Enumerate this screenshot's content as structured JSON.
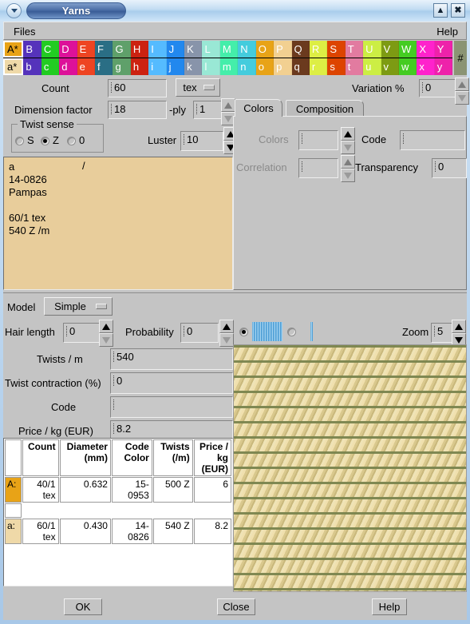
{
  "window": {
    "title": "Yarns",
    "menu_icon": "chevron-down-icon",
    "shade_icon": "shade-icon",
    "close_icon": "close-icon"
  },
  "menubar": {
    "files": "Files",
    "help": "Help"
  },
  "palette": {
    "hash": "#",
    "upper": [
      {
        "label": "A*",
        "color": "#E8A317",
        "selected": true
      },
      {
        "label": "B",
        "color": "#5533BB"
      },
      {
        "label": "C",
        "color": "#22CC22"
      },
      {
        "label": "D",
        "color": "#DD1199"
      },
      {
        "label": "E",
        "color": "#EE4422"
      },
      {
        "label": "F",
        "color": "#2A6E85"
      },
      {
        "label": "G",
        "color": "#5FA06A"
      },
      {
        "label": "H",
        "color": "#CC2211"
      },
      {
        "label": "I",
        "color": "#55BBFF"
      },
      {
        "label": "J",
        "color": "#2288EE"
      },
      {
        "label": "K",
        "color": "#8894AA"
      },
      {
        "label": "L",
        "color": "#99E8D5"
      },
      {
        "label": "M",
        "color": "#44EEAA"
      },
      {
        "label": "N",
        "color": "#44CCDD"
      },
      {
        "label": "O",
        "color": "#E8A317"
      },
      {
        "label": "P",
        "color": "#F2D091"
      },
      {
        "label": "Q",
        "color": "#6B3A1E"
      },
      {
        "label": "R",
        "color": "#DDEE44"
      },
      {
        "label": "S",
        "color": "#DD4400"
      },
      {
        "label": "T",
        "color": "#E27BA0"
      },
      {
        "label": "U",
        "color": "#CCEE44"
      },
      {
        "label": "V",
        "color": "#7D9B13"
      },
      {
        "label": "W",
        "color": "#44CC22"
      },
      {
        "label": "X",
        "color": "#FF22CC"
      },
      {
        "label": "Y",
        "color": "#EE22AA"
      }
    ],
    "lower": [
      {
        "label": "a*",
        "color": "#EFD9A8",
        "selected": true
      },
      {
        "label": "b",
        "color": "#5533BB"
      },
      {
        "label": "c",
        "color": "#22CC22"
      },
      {
        "label": "d",
        "color": "#DD1199"
      },
      {
        "label": "e",
        "color": "#EE4422"
      },
      {
        "label": "f",
        "color": "#2A6E85"
      },
      {
        "label": "g",
        "color": "#5FA06A"
      },
      {
        "label": "h",
        "color": "#CC2211"
      },
      {
        "label": "i",
        "color": "#55BBFF"
      },
      {
        "label": "j",
        "color": "#2288EE"
      },
      {
        "label": "k",
        "color": "#8894AA"
      },
      {
        "label": "l",
        "color": "#99E8D5"
      },
      {
        "label": "m",
        "color": "#44EEAA"
      },
      {
        "label": "n",
        "color": "#44CCDD"
      },
      {
        "label": "o",
        "color": "#E8A317"
      },
      {
        "label": "p",
        "color": "#F2D091"
      },
      {
        "label": "q",
        "color": "#6B3A1E"
      },
      {
        "label": "r",
        "color": "#DDEE44"
      },
      {
        "label": "s",
        "color": "#DD4400"
      },
      {
        "label": "t",
        "color": "#E27BA0"
      },
      {
        "label": "u",
        "color": "#CCEE44"
      },
      {
        "label": "v",
        "color": "#7D9B13"
      },
      {
        "label": "w",
        "color": "#44CC22"
      },
      {
        "label": "x",
        "color": "#FF22CC"
      },
      {
        "label": "y",
        "color": "#EE22AA"
      }
    ]
  },
  "upper_form": {
    "count_label": "Count",
    "count_value": "60",
    "unit_label": "tex",
    "dimension_label": "Dimension factor",
    "dimension_value": "18",
    "ply_label": "-ply",
    "ply_value": "1",
    "variation_label": "Variation %",
    "variation_value": "0",
    "luster_label": "Luster",
    "luster_value": "10",
    "twist_sense_title": "Twist sense",
    "twist_sense_options": [
      "S",
      "Z",
      "0"
    ],
    "twist_sense_selected": "Z"
  },
  "notebook": {
    "tabs": [
      {
        "label": "Colors",
        "active": true
      },
      {
        "label": "Composition",
        "active": false
      }
    ],
    "colors_label": "Colors",
    "colors_value": "",
    "code_label": "Code",
    "code_value": "",
    "correlation_label": "Correlation",
    "correlation_value": "",
    "transparency_label": "Transparency",
    "transparency_value": "0"
  },
  "preview_text": {
    "line1": "a",
    "slash": "/",
    "line2": "14-0826",
    "line3": "Pampas",
    "line4": "",
    "line5": "60/1 tex",
    "line6": "540 Z /m"
  },
  "lower_form": {
    "model_label": "Model",
    "model_value": "Simple",
    "hair_length_label": "Hair length",
    "hair_length_value": "0",
    "probability_label": "Probability",
    "probability_value": "0",
    "zoom_label": "Zoom",
    "zoom_value": "5",
    "twists_label": "Twists / m",
    "twists_value": "540",
    "contraction_label": "Twist contraction (%)",
    "contraction_value": "0",
    "code_label": "Code",
    "code_value": "",
    "price_label": "Price / kg (EUR)",
    "price_value": "8.2",
    "view_mode_options": [
      "yarn-sample",
      "thread-line"
    ],
    "view_mode_selected": "yarn-sample"
  },
  "table": {
    "headers": [
      "",
      "Count",
      "Diameter (mm)",
      "Code Color",
      "Twists (/m)",
      "Price / kg (EUR)"
    ],
    "rows": [
      {
        "key": "A:",
        "key_color": "#E8A317",
        "cells": [
          "40/1 tex",
          "0.632",
          "15-0953",
          "500 Z",
          "6"
        ]
      },
      {
        "key": "a:",
        "key_color": "#EFD9A8",
        "cells": [
          "60/1 tex",
          "0.430",
          "14-0826",
          "540 Z",
          "8.2"
        ]
      }
    ]
  },
  "buttons": {
    "ok": "OK",
    "close": "Close",
    "help": "Help"
  }
}
